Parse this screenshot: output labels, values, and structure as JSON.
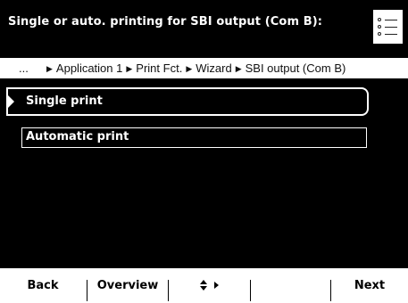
{
  "header": {
    "title": "Single or auto. printing for SBI output (Com B):",
    "menu_icon": "list-menu-icon"
  },
  "breadcrumb": {
    "ellipsis": "...",
    "items": [
      "Application 1",
      "Print Fct.",
      "Wizard",
      "SBI output (Com B)"
    ]
  },
  "options": [
    {
      "label": "Single print",
      "selected": true
    },
    {
      "label": "Automatic print",
      "selected": false
    }
  ],
  "softkeys": {
    "back": "Back",
    "overview": "Overview",
    "navigate_icon": "up-down-right-arrows-icon",
    "blank": "",
    "next": "Next"
  },
  "colors": {
    "background": "#000000",
    "foreground": "#ffffff"
  }
}
